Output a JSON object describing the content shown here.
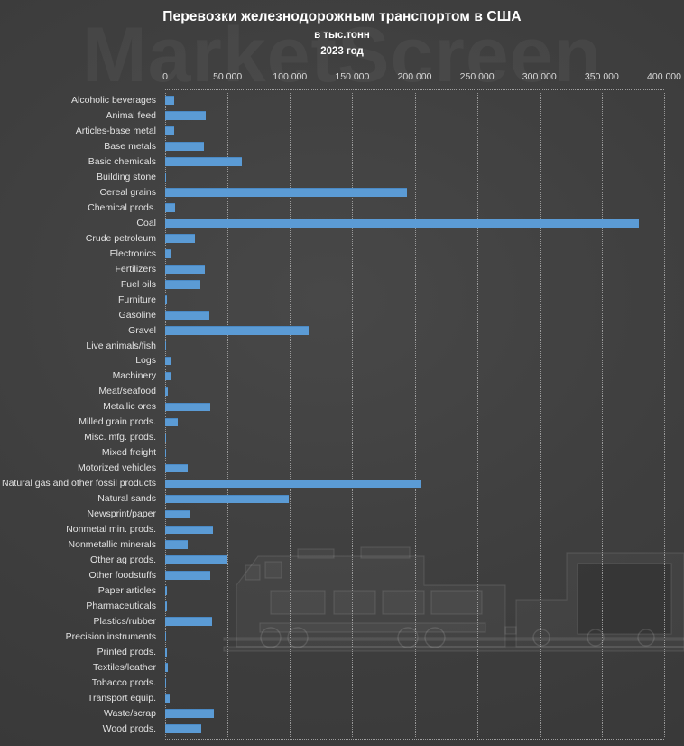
{
  "watermark": "MarketScreen",
  "titles": {
    "main": "Перевозки железнодорожным транспортом в США",
    "sub": "в тыс.тонн",
    "sub2": "2023 год"
  },
  "chart_data": {
    "type": "bar",
    "orientation": "horizontal",
    "title": "Перевозки железнодорожным транспортом в США",
    "subtitle": "в тыс.тонн",
    "year": "2023 год",
    "xlabel": "",
    "ylabel": "",
    "xlim": [
      0,
      400000
    ],
    "xticks": [
      0,
      50000,
      100000,
      150000,
      200000,
      250000,
      300000,
      350000,
      400000
    ],
    "xtick_labels": [
      "0",
      "50 000",
      "100 000",
      "150 000",
      "200 000",
      "250 000",
      "300 000",
      "350 000",
      "400 000"
    ],
    "grid": true,
    "legend": false,
    "bar_color": "#5b9bd5",
    "background_color": "#3f3f3f",
    "text_color": "#e2e2e2",
    "categories": [
      "Alcoholic beverages",
      "Animal feed",
      "Articles-base metal",
      "Base metals",
      "Basic chemicals",
      "Building stone",
      "Cereal grains",
      "Chemical prods.",
      "Coal",
      "Crude petroleum",
      "Electronics",
      "Fertilizers",
      "Fuel oils",
      "Furniture",
      "Gasoline",
      "Gravel",
      "Live animals/fish",
      "Logs",
      "Machinery",
      "Meat/seafood",
      "Metallic ores",
      "Milled grain prods.",
      "Misc. mfg. prods.",
      "Mixed freight",
      "Motorized vehicles",
      "Natural gas and other fossil products",
      "Natural sands",
      "Newsprint/paper",
      "Nonmetal min. prods.",
      "Nonmetallic minerals",
      "Other ag prods.",
      "Other foodstuffs",
      "Paper articles",
      "Pharmaceuticals",
      "Plastics/rubber",
      "Precision instruments",
      "Printed prods.",
      "Textiles/leather",
      "Tobacco prods.",
      "Transport equip.",
      "Waste/scrap",
      "Wood prods."
    ],
    "values": [
      7200,
      32600,
      7200,
      31400,
      61500,
      900,
      193600,
      7600,
      380000,
      24200,
      4000,
      31900,
      28500,
      1100,
      35800,
      114700,
      600,
      5300,
      5300,
      2000,
      36200,
      10100,
      700,
      800,
      18100,
      205600,
      99000,
      20500,
      38100,
      18100,
      50200,
      36200,
      1700,
      1700,
      37400,
      500,
      1700,
      2400,
      300,
      3500,
      39100,
      28900
    ]
  }
}
